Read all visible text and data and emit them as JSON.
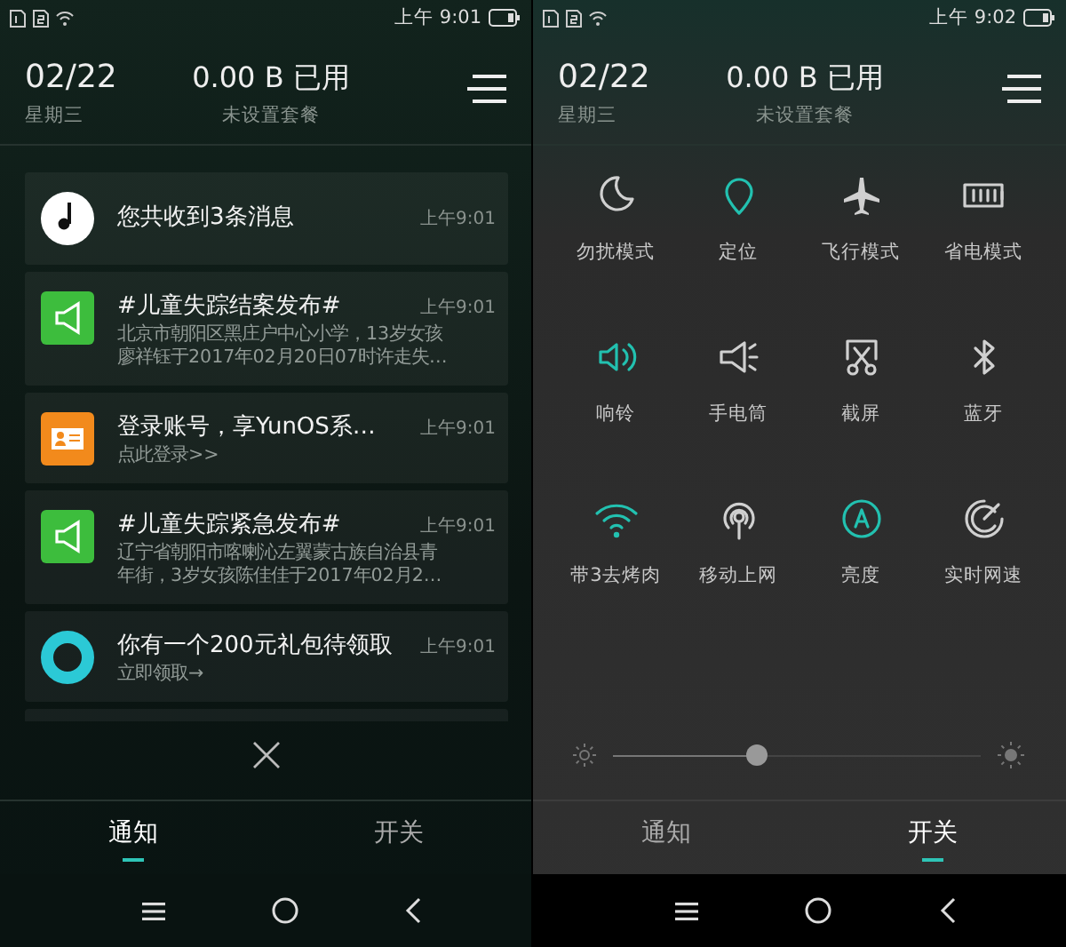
{
  "panels": [
    {
      "status_bar": {
        "time": "上午 9:01"
      },
      "header": {
        "date": "02/22",
        "weekday": "星期三",
        "data_usage": "0.00 B 已用",
        "plan": "未设置套餐"
      },
      "notifications": [
        {
          "title": "您共收到3条消息",
          "time": "上午9:01"
        },
        {
          "title": "#儿童失踪结案发布#",
          "body": "北京市朝阳区黑庄户中心小学，13岁女孩",
          "body2": "廖祥钰于2017年02月20日07时许走失…",
          "time": "上午9:01"
        },
        {
          "title": "登录账号，享YunOS系…",
          "body": "点此登录>>",
          "time": "上午9:01"
        },
        {
          "title": "#儿童失踪紧急发布#",
          "body": "辽宁省朝阳市喀喇沁左翼蒙古族自治县青",
          "body2": "年街，3岁女孩陈佳佳于2017年02月2…",
          "time": "上午9:01"
        },
        {
          "title": "你有一个200元礼包待领取",
          "body": "立即领取→",
          "time": "上午9:01"
        }
      ],
      "tabs": [
        {
          "label": "通知",
          "selected": true
        },
        {
          "label": "开关",
          "selected": false
        }
      ]
    },
    {
      "status_bar": {
        "time": "上午 9:02"
      },
      "header": {
        "date": "02/22",
        "weekday": "星期三",
        "data_usage": "0.00 B 已用",
        "plan": "未设置套餐"
      },
      "toggles": [
        {
          "label": "勿扰模式",
          "on": false
        },
        {
          "label": "定位",
          "on": true
        },
        {
          "label": "飞行模式",
          "on": false
        },
        {
          "label": "省电模式",
          "on": false
        },
        {
          "label": "响铃",
          "on": true
        },
        {
          "label": "手电筒",
          "on": false
        },
        {
          "label": "截屏",
          "on": false
        },
        {
          "label": "蓝牙",
          "on": false
        },
        {
          "label": "带3去烤肉",
          "on": true
        },
        {
          "label": "移动上网",
          "on": false
        },
        {
          "label": "亮度",
          "on": true
        },
        {
          "label": "实时网速",
          "on": false
        }
      ],
      "brightness": {
        "level": 0.39
      },
      "tabs": [
        {
          "label": "通知",
          "selected": false
        },
        {
          "label": "开关",
          "selected": true
        }
      ]
    }
  ]
}
